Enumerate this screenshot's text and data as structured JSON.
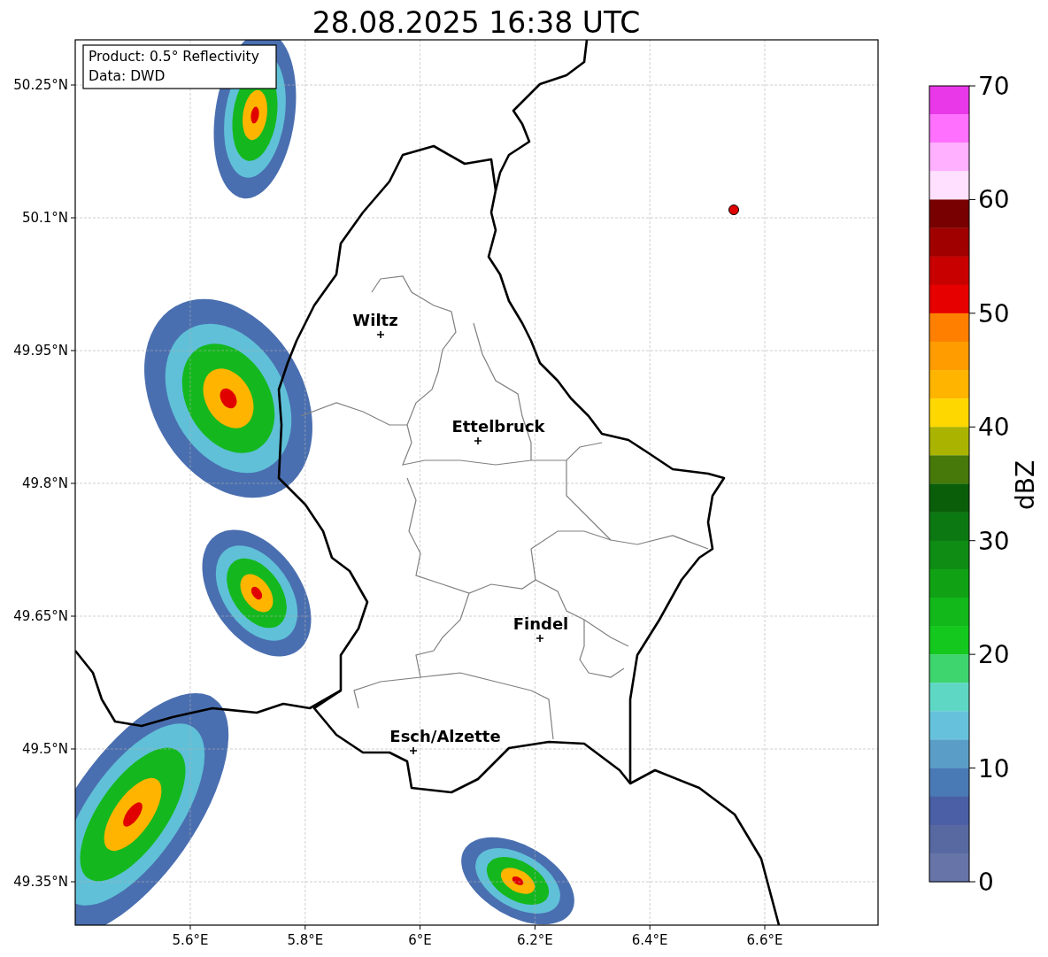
{
  "title": "28.08.2025 16:38 UTC",
  "info_box": {
    "lines": [
      "Product: 0.5° Reflectivity",
      "Data: DWD"
    ]
  },
  "map": {
    "lat_ticks": [
      "50.25°N",
      "50.1°N",
      "49.95°N",
      "49.8°N",
      "49.65°N",
      "49.5°N",
      "49.35°N"
    ],
    "lon_ticks": [
      "5.6°E",
      "5.8°E",
      "6°E",
      "6.2°E",
      "6.4°E",
      "6.6°E"
    ],
    "cities": [
      {
        "name": "Wiltz"
      },
      {
        "name": "Ettelbruck"
      },
      {
        "name": "Findel"
      },
      {
        "name": "Esch/Alzette"
      }
    ]
  },
  "colorbar": {
    "label": "dBZ",
    "ticks": [
      "70",
      "60",
      "50",
      "40",
      "30",
      "20",
      "10",
      "0"
    ],
    "segments": [
      {
        "color": "#e838e8"
      },
      {
        "color": "#ff70ff"
      },
      {
        "color": "#ffb0ff"
      },
      {
        "color": "#ffe0ff"
      },
      {
        "color": "#780000"
      },
      {
        "color": "#a00000"
      },
      {
        "color": "#c80000"
      },
      {
        "color": "#e60000"
      },
      {
        "color": "#ff8000"
      },
      {
        "color": "#ff9c00"
      },
      {
        "color": "#ffb400"
      },
      {
        "color": "#ffd700"
      },
      {
        "color": "#aab400"
      },
      {
        "color": "#46780a"
      },
      {
        "color": "#0a5e0a"
      },
      {
        "color": "#0c7812"
      },
      {
        "color": "#0e8c14"
      },
      {
        "color": "#10a214"
      },
      {
        "color": "#12b81a"
      },
      {
        "color": "#14c81e"
      },
      {
        "color": "#3ed46e"
      },
      {
        "color": "#5ed8c4"
      },
      {
        "color": "#66c2dc"
      },
      {
        "color": "#5a9ec8"
      },
      {
        "color": "#4a7ab5"
      },
      {
        "color": "#4a5fa5"
      },
      {
        "color": "#5868a0"
      },
      {
        "color": "#6674a8"
      }
    ]
  }
}
